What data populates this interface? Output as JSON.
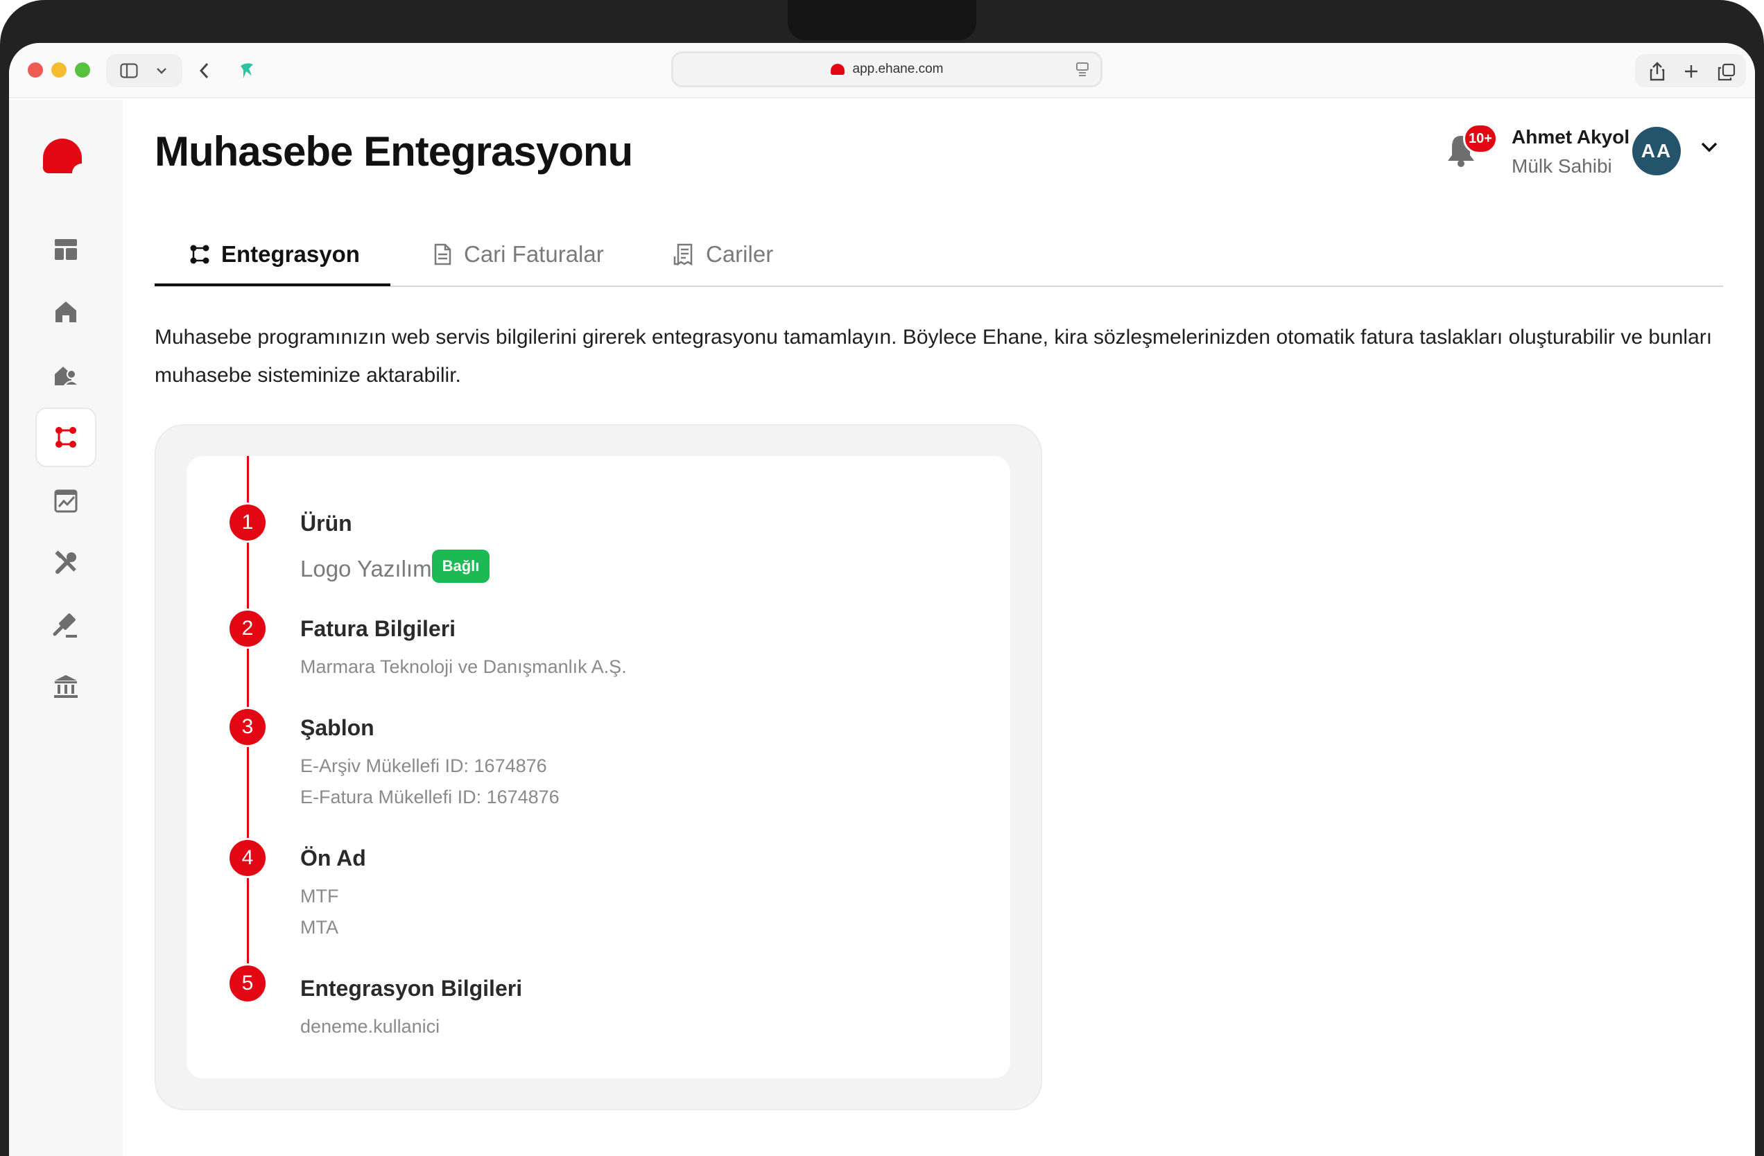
{
  "browser": {
    "url": "app.ehane.com"
  },
  "sidebar": {
    "items": [
      {
        "name": "dashboard-icon"
      },
      {
        "name": "home-icon"
      },
      {
        "name": "tenant-icon"
      },
      {
        "name": "integration-icon",
        "active": true
      },
      {
        "name": "reports-icon"
      },
      {
        "name": "tools-icon"
      },
      {
        "name": "legal-icon"
      },
      {
        "name": "bank-icon"
      }
    ]
  },
  "header": {
    "title": "Muhasebe Entegrasyonu",
    "notification_count": "10+",
    "user_name": "Ahmet Akyol",
    "user_role": "Mülk Sahibi",
    "avatar_initials": "AA"
  },
  "tabs": [
    {
      "label": "Entegrasyon",
      "active": true
    },
    {
      "label": "Cari Faturalar",
      "active": false
    },
    {
      "label": "Cariler",
      "active": false
    }
  ],
  "description": "Muhasebe programınızın web servis bilgilerini girerek entegrasyonu tamamlayın. Böylece Ehane, kira sözleşmelerinizden otomatik fatura taslakları oluşturabilir ve bunları muhasebe sisteminize aktarabilir.",
  "steps": [
    {
      "number": "1",
      "title": "Ürün",
      "values": [
        "Logo Yazılım"
      ],
      "status": "Bağlı"
    },
    {
      "number": "2",
      "title": "Fatura Bilgileri",
      "values": [
        "Marmara Teknoloji ve Danışmanlık A.Ş."
      ]
    },
    {
      "number": "3",
      "title": "Şablon",
      "values": [
        "E-Arşiv Mükellefi ID: 1674876",
        "E-Fatura Mükellefi ID: 1674876"
      ]
    },
    {
      "number": "4",
      "title": "Ön Ad",
      "values": [
        "MTF",
        "MTA"
      ]
    },
    {
      "number": "5",
      "title": "Entegrasyon Bilgileri",
      "values": [
        "deneme.kullanici"
      ]
    }
  ],
  "colors": {
    "brand": "#e30613",
    "connected": "#1db954",
    "avatar": "#23546b"
  }
}
